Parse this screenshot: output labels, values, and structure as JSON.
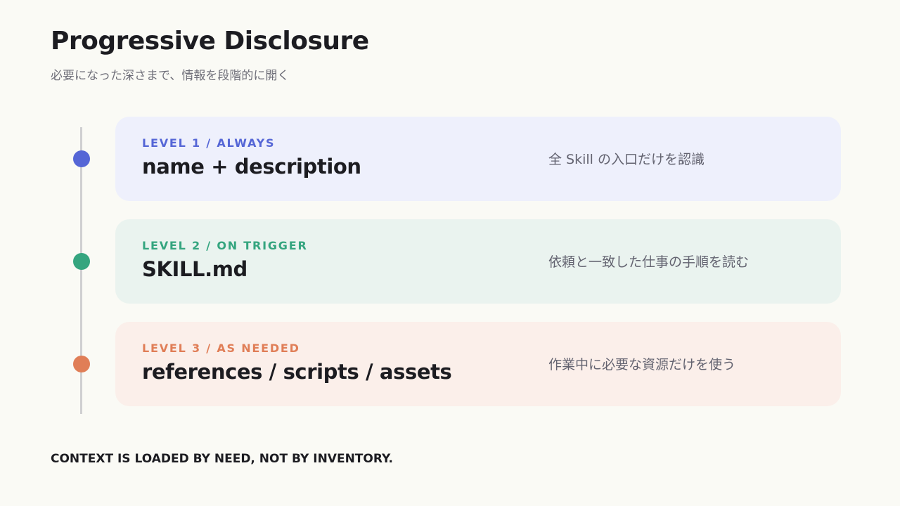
{
  "header": {
    "title": "Progressive Disclosure",
    "subtitle": "必要になった深さまで、情報を段階的に開く"
  },
  "levels": [
    {
      "label": "LEVEL 1 / ALWAYS",
      "name": "name + description",
      "description": "全 Skill の入口だけを認識",
      "accent_color": "#5566d6",
      "card_color": "#eef0fc"
    },
    {
      "label": "LEVEL 2 / ON TRIGGER",
      "name": "SKILL.md",
      "description": "依頼と一致した仕事の手順を読む",
      "accent_color": "#35a57f",
      "card_color": "#eaf3ef"
    },
    {
      "label": "LEVEL 3 / AS NEEDED",
      "name": "references / scripts / assets",
      "description": "作業中に必要な資源だけを使う",
      "accent_color": "#e07e57",
      "card_color": "#fbefea"
    }
  ],
  "footer": {
    "text": "CONTEXT IS LOADED BY NEED, NOT BY INVENTORY."
  }
}
